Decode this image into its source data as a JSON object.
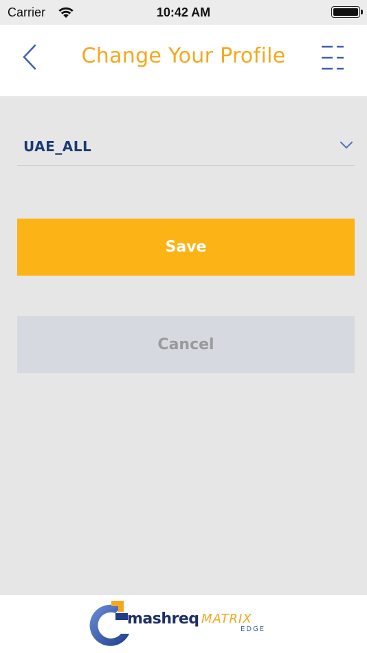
{
  "status_bar": {
    "carrier": "Carrier",
    "time": "10:42 AM",
    "battery_level": 1.0
  },
  "header": {
    "title": "Change Your Profile",
    "back_icon": "chevron-left-icon",
    "menu_icon": "menu-icon",
    "title_color": "#f5a81d"
  },
  "profile_select": {
    "selected_value": "UAE_ALL",
    "value_color": "#1c3b73"
  },
  "actions": {
    "save_label": "Save",
    "cancel_label": "Cancel",
    "save_color": "#fbb315",
    "cancel_color": "#d6d9df"
  },
  "footer": {
    "logo": {
      "brand_word": "mashreq",
      "product_word": "MATRIX",
      "tagline": "EDGE"
    }
  }
}
